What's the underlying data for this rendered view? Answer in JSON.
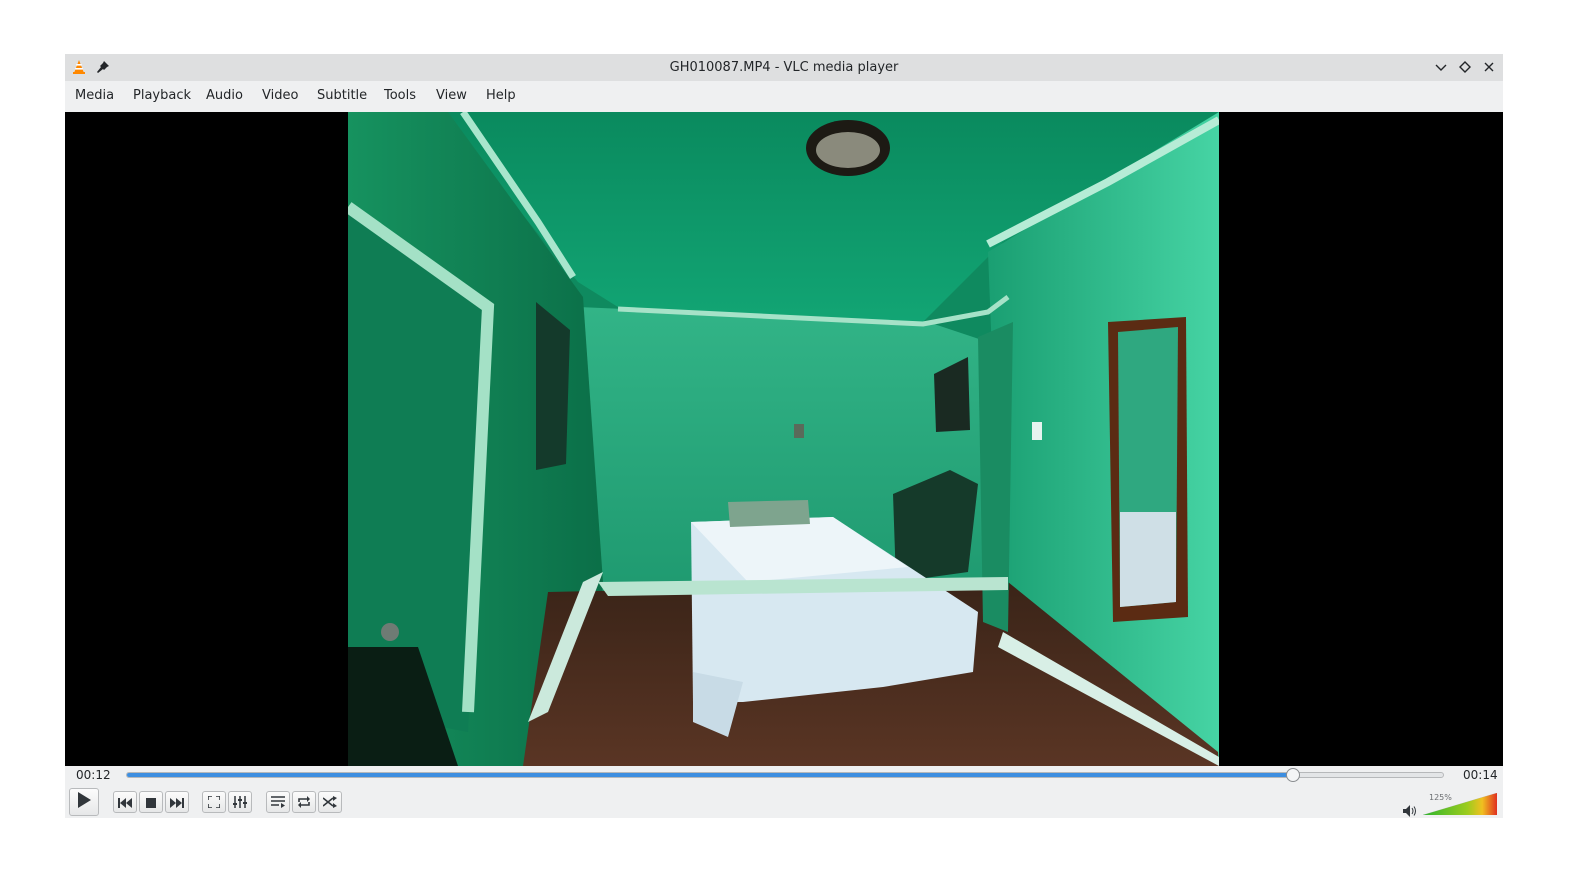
{
  "window": {
    "title": "GH010087.MP4 - VLC media player"
  },
  "titlebar_icons": {
    "app": "vlc-cone-icon",
    "pin": "pin-icon",
    "minimize": "chevron-down-icon",
    "maximize": "diamond-icon",
    "close": "close-icon"
  },
  "menu": [
    {
      "label": "Media"
    },
    {
      "label": "Playback"
    },
    {
      "label": "Audio"
    },
    {
      "label": "Video"
    },
    {
      "label": "Subtitle"
    },
    {
      "label": "Tools"
    },
    {
      "label": "View"
    },
    {
      "label": "Help"
    }
  ],
  "playback": {
    "elapsed": "00:12",
    "total": "00:14",
    "progress": 0.886
  },
  "controls": {
    "play": "play-icon",
    "previous": "previous-icon",
    "stop": "stop-icon",
    "next": "next-icon",
    "fullscreen": "fullscreen-icon",
    "extended_settings": "equalizer-icon",
    "playlist": "playlist-icon",
    "loop": "loop-icon",
    "random": "shuffle-icon"
  },
  "volume": {
    "label": "125%",
    "level": 1.25,
    "icon": "speaker-icon"
  },
  "colors": {
    "accent": "#3d8ee0",
    "video_bg": "#000000",
    "volume_low": "#2db52d",
    "volume_high": "#e03020"
  }
}
